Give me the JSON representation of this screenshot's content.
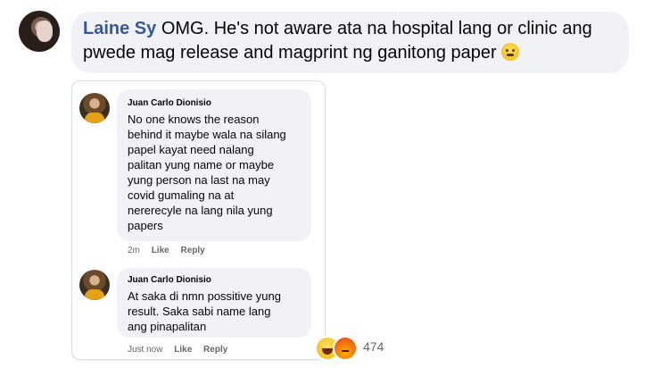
{
  "main_comment": {
    "author": "Laine Sy",
    "text_line1": "OMG. He's not aware ata na hospital lang or clinic ang",
    "text_line2": "pwede mag release and magprint ng ganitong paper"
  },
  "replies": [
    {
      "author": "Juan Carlo Dionisio",
      "lines": [
        "No one knows the reason",
        "behind it maybe wala na silang",
        "papel kayat need nalang",
        "palitan yung name or maybe",
        "yung person na last na may",
        "covid gumaling na at",
        "nererecyle na lang nila yung",
        "papers"
      ],
      "time": "2m",
      "like_label": "Like",
      "reply_label": "Reply"
    },
    {
      "author": "Juan Carlo Dionisio",
      "lines": [
        "At saka di nmn possitive yung",
        "result. Saka sabi name lang",
        "ang pinapalitan"
      ],
      "time": "Just now",
      "like_label": "Like",
      "reply_label": "Reply"
    }
  ],
  "reactions": {
    "types": [
      "haha-icon",
      "angry-icon"
    ],
    "count": "474"
  },
  "colors": {
    "author_link": "#385898",
    "bubble_bg": "#f0f2f5",
    "meta_text": "#65676b"
  }
}
